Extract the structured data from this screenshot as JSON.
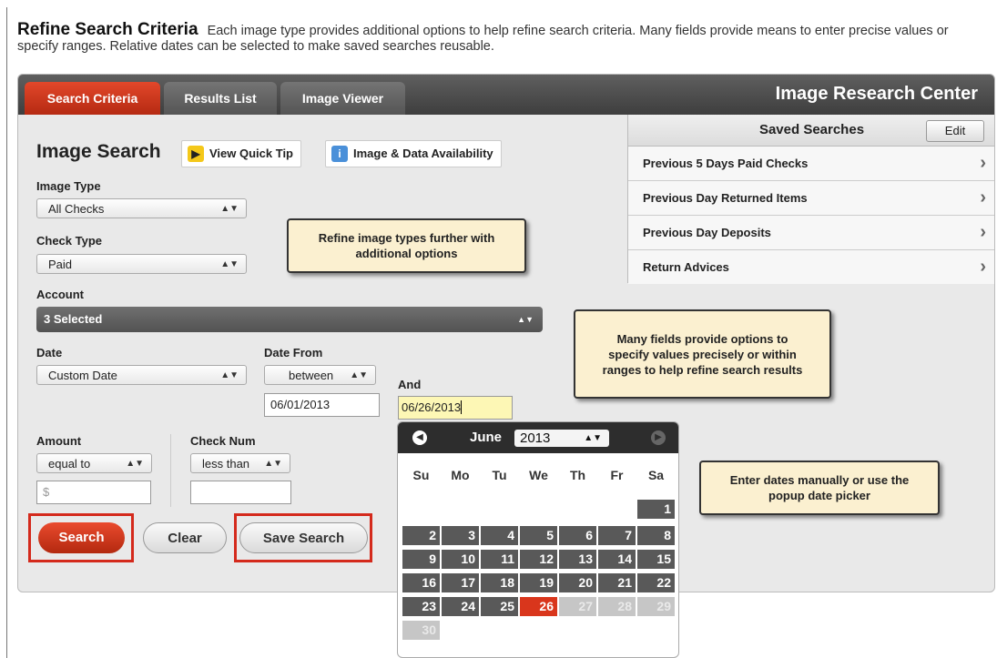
{
  "intro": {
    "heading": "Refine Search Criteria",
    "text": "Each image type provides additional options to help refine search criteria. Many fields provide means to enter precise values or specify ranges. Relative dates can be selected to make saved searches reusable."
  },
  "tabs": [
    "Search Criteria",
    "Results List",
    "Image Viewer"
  ],
  "brand": "Image Research Center",
  "saved_searches": {
    "title": "Saved Searches",
    "edit_label": "Edit",
    "items": [
      "Previous 5 Days Paid Checks",
      "Previous Day Returned Items",
      "Previous Day Deposits",
      "Return Advices"
    ]
  },
  "form": {
    "title": "Image Search",
    "quick_tip": "View Quick Tip",
    "availability": "Image & Data Availability",
    "image_type_label": "Image Type",
    "image_type_value": "All Checks",
    "check_type_label": "Check Type",
    "check_type_value": "Paid",
    "account_label": "Account",
    "account_value": "3 Selected",
    "date_label": "Date",
    "date_value": "Custom Date",
    "date_from_label": "Date From",
    "date_from_op": "between",
    "date_from_value": "06/01/2013",
    "and_label": "And",
    "date_to_value": "06/26/2013",
    "amount_label": "Amount",
    "amount_op": "equal to",
    "amount_placeholder": "$",
    "checknum_label": "Check Num",
    "checknum_op": "less than",
    "search_label": "Search",
    "clear_label": "Clear",
    "save_label": "Save Search"
  },
  "callouts": {
    "refine": "Refine image types further with additional options",
    "fields": "Many fields provide options to specify values precisely or within ranges to help refine search results",
    "dates": "Enter dates manually or use the popup date picker"
  },
  "calendar": {
    "month": "June",
    "year": "2013",
    "weekdays": [
      "Su",
      "Mo",
      "Tu",
      "We",
      "Th",
      "Fr",
      "Sa"
    ],
    "first_weekday_index": 6,
    "days_in_month": 30,
    "selected_day": 26
  }
}
